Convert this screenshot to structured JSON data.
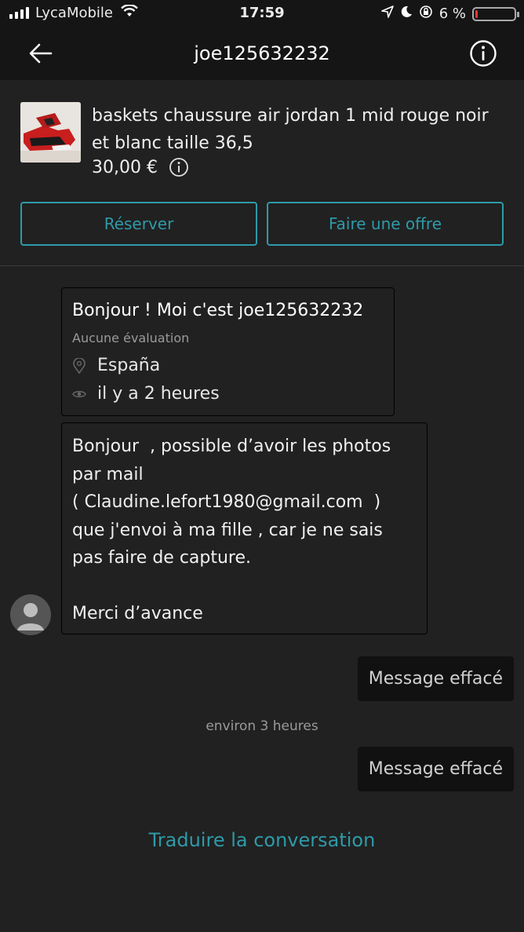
{
  "status_bar": {
    "carrier": "LycaMobile",
    "time": "17:59",
    "battery_percent": "6 %",
    "battery_level": 0.06,
    "battery_color": "#e53935"
  },
  "header": {
    "title": "joe125632232",
    "back_icon": "arrow-left-icon",
    "info_icon": "info-circle-icon"
  },
  "item": {
    "title": "baskets chaussure air jordan 1 mid rouge noir et blanc taille 36,5",
    "price": "30,00 €",
    "reserve_label": "Réserver",
    "offer_label": "Faire une offre"
  },
  "intro": {
    "title": "Bonjour ! Moi c'est joe125632232",
    "rating": "Aucune évaluation",
    "location": "España",
    "last_seen": "il y a 2 heures"
  },
  "message": {
    "text": "Bonjour  , possible d’avoir les photos par mail\n( Claudine.lefort1980@gmail.com  )\nque j'envoi à ma fille , car je ne sais pas faire de capture.\n\nMerci d’avance"
  },
  "sent_messages": [
    {
      "text": "Message effacé"
    },
    {
      "text": "Message effacé"
    }
  ],
  "timestamp": "environ 3 heures",
  "translate_label": "Traduire la conversation",
  "colors": {
    "accent": "#2e9aa8",
    "background": "#212121",
    "header": "#151515"
  }
}
